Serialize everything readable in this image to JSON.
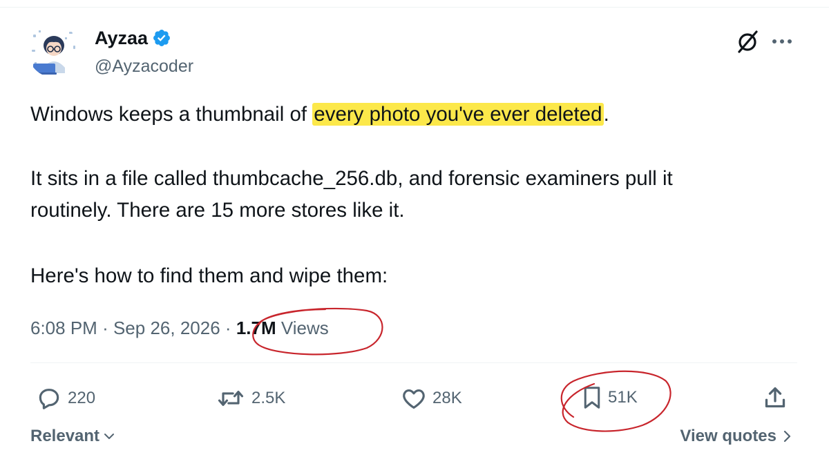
{
  "author": {
    "display_name": "Ayzaa",
    "handle": "@Ayzacoder",
    "verified": true
  },
  "header_actions": {
    "grok_icon": "grok-slash-circle-icon",
    "more_icon": "more-dots-icon"
  },
  "tweet": {
    "line1_prefix": "Windows keeps a thumbnail of ",
    "line1_highlight": "every photo you've ever deleted",
    "line1_suffix": ".",
    "line2": "It sits in a file called thumbcache_256.db, and forensic examiners pull it",
    "line3": "routinely. There are 15 more stores like it.",
    "line4": "Here's how to find them and wipe them:"
  },
  "meta": {
    "time": "6:08 PM",
    "separator": "·",
    "date": "Sep 26, 2026",
    "views_count": "1.7M",
    "views_label": "Views"
  },
  "actions": {
    "replies": "220",
    "reposts": "2.5K",
    "likes": "28K",
    "bookmarks": "51K"
  },
  "footer": {
    "sort_label": "Relevant",
    "quotes_label": "View quotes"
  },
  "colors": {
    "text_primary": "#0f1419",
    "text_secondary": "#536471",
    "verified_blue": "#1d9bf0",
    "highlight_yellow": "#fce84a",
    "annotation_red": "#c8252c",
    "divider": "#eff3f4"
  }
}
